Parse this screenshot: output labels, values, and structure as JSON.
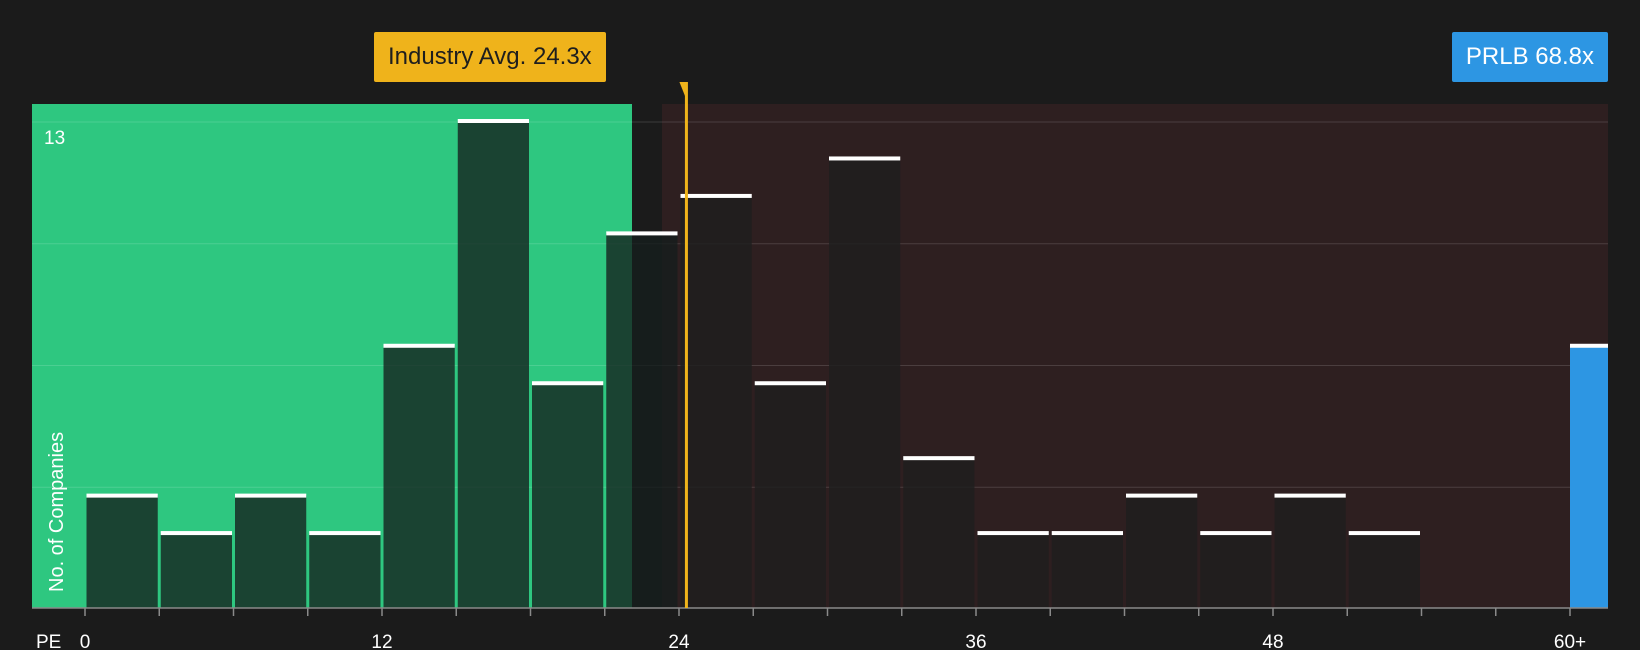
{
  "colors": {
    "background": "#1b1b1b",
    "below_avg_region": "#2ec780",
    "above_avg_region": "#2e1f20",
    "bar_fill_dark": "#1f1f1f",
    "bar_cap": "#ffffff",
    "industry_avg": "#efb31b",
    "company": "#2d96e3"
  },
  "callouts": {
    "industry_avg_label": "Industry Avg. 24.3x",
    "company_label": "PRLB 68.8x"
  },
  "chart_data": {
    "type": "bar",
    "xlabel": "PE",
    "ylabel": "No. of Companies",
    "xlim": [
      0,
      60
    ],
    "ylim": [
      0,
      13
    ],
    "x_ticks": [
      "0",
      "12",
      "24",
      "36",
      "48",
      "60+"
    ],
    "y_ticks": [
      "13"
    ],
    "grid": true,
    "bin_width": 3,
    "bins": [
      {
        "start": 0,
        "end": 3,
        "count": 3
      },
      {
        "start": 3,
        "end": 6,
        "count": 2
      },
      {
        "start": 6,
        "end": 9,
        "count": 3
      },
      {
        "start": 9,
        "end": 12,
        "count": 2
      },
      {
        "start": 12,
        "end": 15,
        "count": 7
      },
      {
        "start": 15,
        "end": 18,
        "count": 13
      },
      {
        "start": 18,
        "end": 21,
        "count": 6
      },
      {
        "start": 21,
        "end": 24,
        "count": 10
      },
      {
        "start": 24,
        "end": 27,
        "count": 11
      },
      {
        "start": 27,
        "end": 30,
        "count": 6
      },
      {
        "start": 30,
        "end": 33,
        "count": 12
      },
      {
        "start": 33,
        "end": 36,
        "count": 4
      },
      {
        "start": 36,
        "end": 39,
        "count": 2
      },
      {
        "start": 39,
        "end": 42,
        "count": 2
      },
      {
        "start": 42,
        "end": 45,
        "count": 3
      },
      {
        "start": 45,
        "end": 48,
        "count": 2
      },
      {
        "start": 48,
        "end": 51,
        "count": 3
      },
      {
        "start": 51,
        "end": 54,
        "count": 2
      },
      {
        "start": 54,
        "end": 57,
        "count": 0
      },
      {
        "start": 57,
        "end": 60,
        "count": 0
      },
      {
        "start": 60,
        "end": 61.5,
        "count": 7,
        "highlight": true
      }
    ],
    "industry_avg": 24.3,
    "company_value": 68.8,
    "company_name": "PRLB"
  }
}
